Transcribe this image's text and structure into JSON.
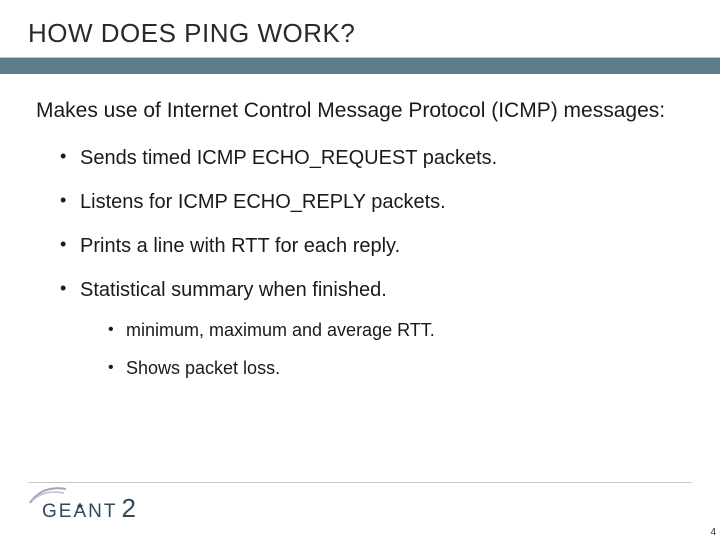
{
  "slide": {
    "title": "HOW DOES PING WORK?",
    "intro": "Makes use of Internet Control Message Protocol (ICMP) messages:",
    "bullets": [
      {
        "text": "Sends timed ICMP ECHO_REQUEST packets."
      },
      {
        "text": "Listens for ICMP ECHO_REPLY packets."
      },
      {
        "text": "Prints a line with RTT for each reply."
      },
      {
        "text": "Statistical summary when finished.",
        "sub": [
          "minimum, maximum and average RTT.",
          "Shows packet loss."
        ]
      }
    ]
  },
  "logo": {
    "text": "GEANT",
    "suffix": "2"
  },
  "page_number": "4",
  "colors": {
    "accent": "#5e7c8a",
    "logo": "#2f4a5a"
  }
}
